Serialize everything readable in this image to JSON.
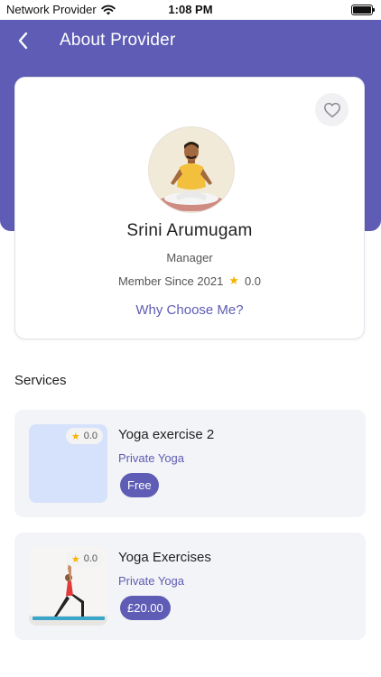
{
  "status_bar": {
    "carrier": "Network Provider",
    "time": "1:08 PM"
  },
  "header": {
    "title": "About Provider"
  },
  "provider": {
    "name": "Srini Arumugam",
    "role": "Manager",
    "member_since": "Member Since 2021",
    "rating": "0.0",
    "why_link": "Why Choose Me?"
  },
  "services": {
    "heading": "Services",
    "items": [
      {
        "title": "Yoga exercise 2",
        "category": "Private Yoga",
        "price": "Free",
        "rating": "0.0"
      },
      {
        "title": "Yoga Exercises",
        "category": "Private Yoga",
        "price": "£20.00",
        "rating": "0.0"
      }
    ]
  },
  "colors": {
    "accent": "#5e5cb4",
    "star": "#f4b400",
    "card_bg": "#f3f4f7"
  }
}
